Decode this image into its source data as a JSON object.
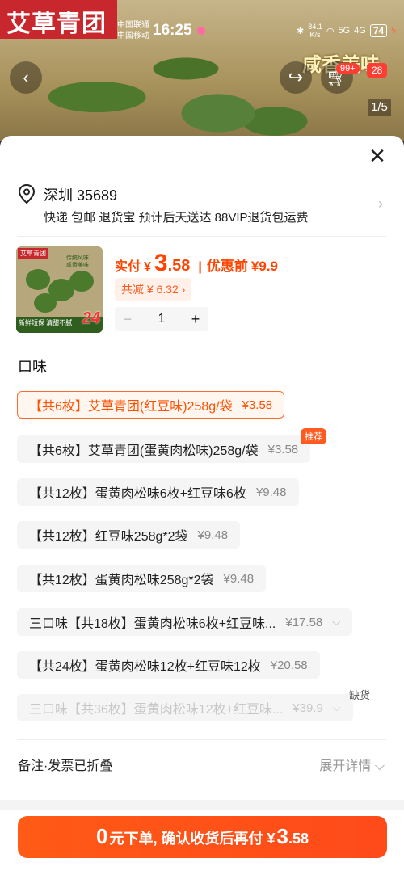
{
  "banner": {
    "brand": "艾草青团",
    "overlay_text": "咸香美味"
  },
  "status_bar": {
    "carrier1": "中国联通",
    "carrier2": "中国移动",
    "time": "16:25",
    "net_speed": "84.1",
    "net_unit": "K/s",
    "net1": "5G",
    "net2": "4G",
    "battery": "74"
  },
  "top_actions": {
    "back_icon": "chevron-left-icon",
    "share_icon": "share-icon",
    "cart_icon": "cart-icon",
    "cart_badge": "99+",
    "num_badge": "28",
    "page_indicator": "1/5"
  },
  "sheet": {
    "close_icon": "close-icon",
    "address": {
      "city": "深圳 35689",
      "detail": "快递 包邮 退货宝 预计后天送达 88VIP退货包运费"
    },
    "product": {
      "thumb_brand": "艾草青团",
      "thumb_tag1": "传统风味",
      "thumb_tag2": "咸香美味",
      "thumb_bottom": "新鲜短保 清甜不腻",
      "thumb_count": "24",
      "price_label": "实付",
      "currency": "¥",
      "price_int": "3",
      "price_dec": ".58",
      "orig_label": "优惠前",
      "orig_price": "¥9.9",
      "discount": "共减 ¥ 6.32 ›",
      "quantity": "1"
    },
    "flavor_title": "口味",
    "options": [
      {
        "label": "【共6枚】艾草青团(红豆味)258g/袋",
        "price": "¥3.58"
      },
      {
        "label": "【共6枚】艾草青团(蛋黄肉松味)258g/袋",
        "price": "¥3.58",
        "tag": "推荐"
      },
      {
        "label": "【共12枚】蛋黄肉松味6枚+红豆味6枚",
        "price": "¥9.48"
      },
      {
        "label": "【共12枚】红豆味258g*2袋",
        "price": "¥9.48"
      },
      {
        "label": "【共12枚】蛋黄肉松味258g*2袋",
        "price": "¥9.48"
      },
      {
        "label": "三口味【共18枚】蛋黄肉松味6枚+红豆味...",
        "price": "¥17.58"
      },
      {
        "label": "【共24枚】蛋黄肉松味12枚+红豆味12枚",
        "price": "¥20.58"
      },
      {
        "label": "三口味【共36枚】蛋黄肉松味12枚+红豆味...",
        "price": "¥39.9",
        "tag": "缺货"
      }
    ],
    "remark": "备注·发票已折叠",
    "expand": "展开详情 ⌵"
  },
  "cta": {
    "big": "0",
    "text": "元下单, 确认收货后再付 ¥",
    "big2": "3",
    "dec": ".58"
  },
  "colors": {
    "accent": "#ff5000",
    "brand_red": "#c8282d"
  }
}
